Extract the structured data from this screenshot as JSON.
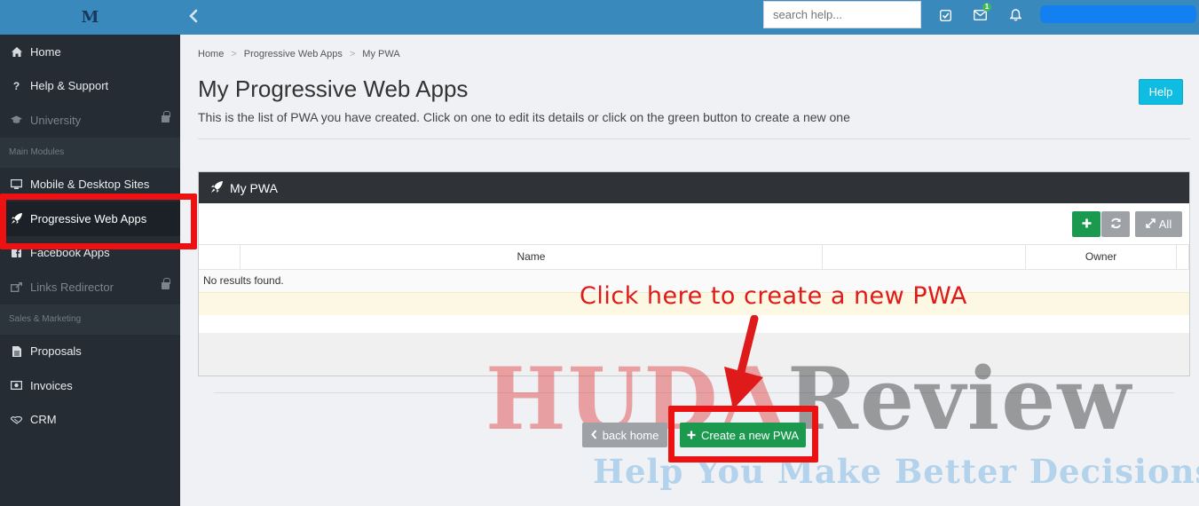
{
  "brand": {
    "logo_text": "M"
  },
  "sidebar": {
    "items": [
      {
        "label": "Home",
        "icon": "home-icon"
      },
      {
        "label": "Help & Support",
        "icon": "question-icon"
      },
      {
        "label": "University",
        "icon": "graduation-cap-icon",
        "locked": true
      }
    ],
    "section_main": "Main Modules",
    "main_items": [
      {
        "label": "Mobile & Desktop Sites",
        "icon": "monitor-icon"
      },
      {
        "label": "Progressive Web Apps",
        "icon": "rocket-icon",
        "active": true
      },
      {
        "label": "Facebook Apps",
        "icon": "facebook-icon"
      },
      {
        "label": "Links Redirector",
        "icon": "share-icon",
        "locked": true
      }
    ],
    "section_sales": "Sales & Marketing",
    "sales_items": [
      {
        "label": "Proposals",
        "icon": "document-icon"
      },
      {
        "label": "Invoices",
        "icon": "money-icon"
      },
      {
        "label": "CRM",
        "icon": "handshake-icon"
      }
    ]
  },
  "topbar": {
    "search_placeholder": "search help...",
    "notification_count": "1"
  },
  "breadcrumb": [
    "Home",
    "Progressive Web Apps",
    "My PWA"
  ],
  "page": {
    "title": "My Progressive Web Apps",
    "description": "This is the list of PWA you have created. Click on one to edit its details or click on the green button to create a new one",
    "help_label": "Help"
  },
  "panel": {
    "title": "My PWA",
    "all_label": "All",
    "columns": [
      "",
      "Name",
      "",
      "Owner"
    ],
    "empty_message": "No results found."
  },
  "actions": {
    "back_label": "back home",
    "create_label": "Create a new PWA"
  },
  "annotation": {
    "text": "Click here to create a new PWA",
    "color": "#de1a1a"
  },
  "watermark": {
    "part1": "HUDA",
    "part2": "Review",
    "tagline": "Help You Make Better Decisions"
  },
  "colors": {
    "topbar": "#3a89bd",
    "sidebar": "#252c33",
    "success": "#1b9a4f",
    "info": "#0fbde3",
    "highlight": "#ee1111"
  }
}
